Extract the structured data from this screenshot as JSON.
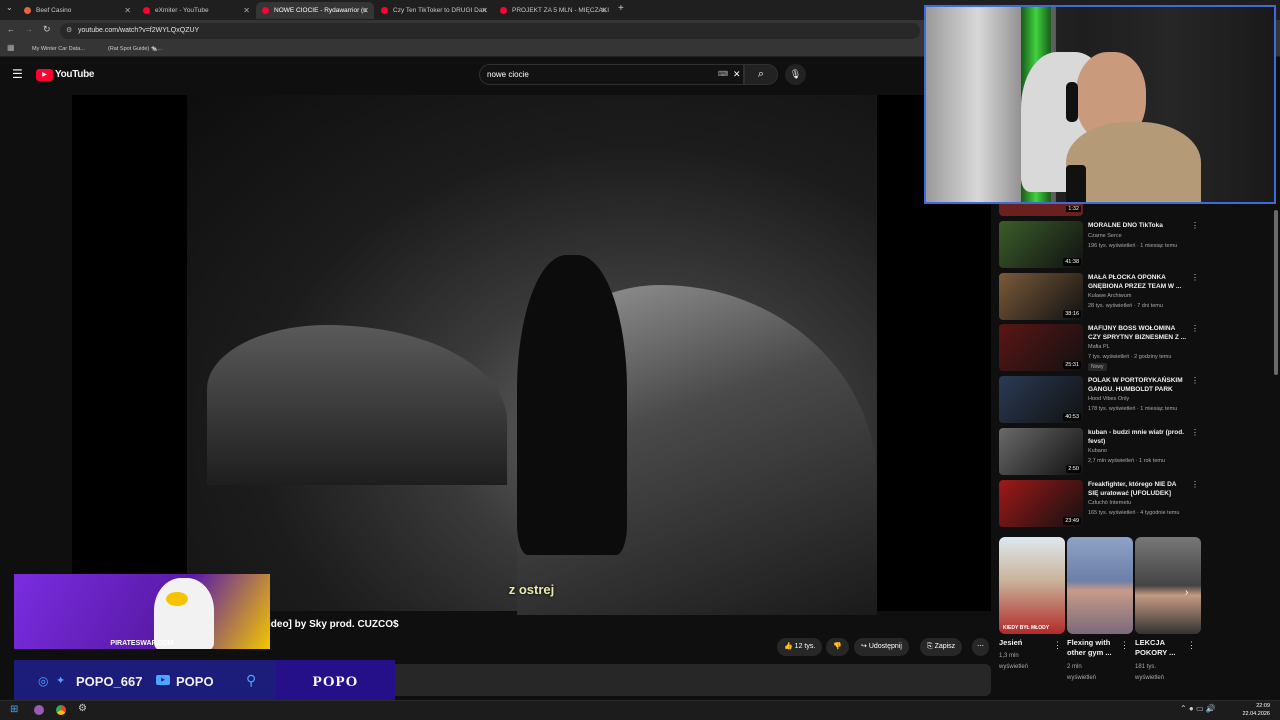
{
  "browser": {
    "tabs": [
      {
        "label": "Beef Casino",
        "color": "#e8643a"
      },
      {
        "label": "eXmiter - YouTube",
        "color": "#ff0033"
      },
      {
        "label": "NOWE CIOCIE - Rydawarrior (o",
        "color": "#ff0033"
      },
      {
        "label": "Czy Ten TikToker to DRUGI Dan",
        "color": "#ff0033"
      },
      {
        "label": "PROJEKT ZA 5 MLN - MIĘCZAKI",
        "color": "#ff0033"
      }
    ],
    "url": "youtube.com/watch?v=f2WYLQxQZUY",
    "bookmarks": [
      "My Winter Car Data...",
      "(Rat Spot Guide) 🐀..."
    ]
  },
  "youtube": {
    "logo": "YouTube",
    "search_query": "nowe ciocie",
    "video": {
      "subtitle": "z ostrej",
      "title_visible": "ideo] by Sky prod. CUZCO$",
      "likes": "12 tys.",
      "share": "Udostępnij",
      "save": "Zapisz"
    },
    "recommendations": [
      {
        "title": "MORALNE DNO TikToka",
        "channel": "Czarne Serce",
        "meta": "196 tys. wyświetleń · 1 miesiąc temu",
        "duration": "41:38",
        "thumb": "#3b5d2a"
      },
      {
        "title": "MAŁA PŁOCKA OPONKA GNĘBIONA PRZEZ TEAM W ...",
        "channel": "Kulawe Archiwum",
        "meta": "28 tys. wyświetleń · 7 dni temu",
        "duration": "38:16",
        "thumb": "#7a5a3a"
      },
      {
        "title": "MAFIJNY BOSS WOŁOMINA CZY SPRYTNY BIZNESMEN Z ...",
        "channel": "Mafia PL",
        "meta": "7 tys. wyświetleń · 2 godziny temu",
        "duration": "25:31",
        "thumb": "#5c1515",
        "badge": "Nowy"
      },
      {
        "title": "POLAK W PORTORYKAŃSKIM GANGU. HUMBOLDT PARK",
        "channel": "Hood Vibes Only",
        "meta": "178 tys. wyświetleń · 1 miesiąc temu",
        "duration": "40:53",
        "thumb": "#2a3a55"
      },
      {
        "title": "kuban - budzi mnie wiatr (prod. fevst)",
        "channel": "Kubano",
        "meta": "2,7 mln wyświetleń · 1 rok temu",
        "duration": "2:50",
        "thumb": "#6a6a6a"
      },
      {
        "title": "Freakfighter, którego NIE DA SIĘ uratować [UFOLUDEK]",
        "channel": "Człuchó Internetu",
        "meta": "165 tys. wyświetleń · 4 tygodnie temu",
        "duration": "23:49",
        "thumb": "#a01818"
      }
    ],
    "top_partial_duration": "1:32",
    "shorts": [
      {
        "title": "Jesień",
        "meta1": "1,3 mln",
        "meta2": "wyświetleń",
        "caption": "KIEDY BYŁ MŁODY",
        "thumb": "#b12a2a"
      },
      {
        "title": "Flexing with other gym ...",
        "meta1": "2 mln",
        "meta2": "wyświetleń",
        "thumb": "#6b7fa8"
      },
      {
        "title": "LEKCJA POKORY ...",
        "meta1": "181 tys.",
        "meta2": "wyświetleń",
        "thumb": "#555555"
      }
    ]
  },
  "overlay": {
    "ad_url": "PIRATESWAP.COM",
    "handle1": "POPO_667",
    "handle2": "POPO",
    "brand": "POPO"
  },
  "taskbar": {
    "time": "22:09",
    "date": "22.04.2026"
  }
}
